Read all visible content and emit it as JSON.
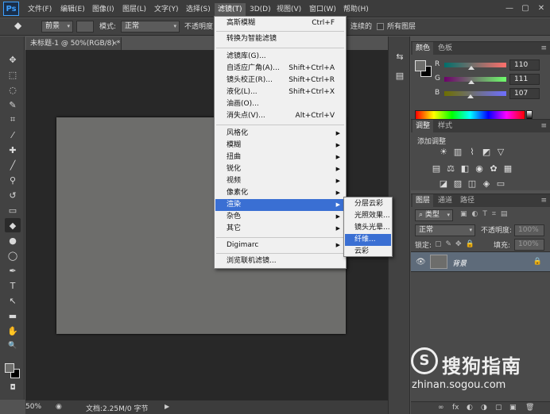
{
  "app": {
    "logo": "Ps"
  },
  "menubar": {
    "items": [
      "文件(F)",
      "编辑(E)",
      "图像(I)",
      "图层(L)",
      "文字(Y)",
      "选择(S)",
      "滤镜(T)",
      "3D(D)",
      "视图(V)",
      "窗口(W)",
      "帮助(H)"
    ],
    "active_index": 6,
    "window_controls": [
      "—",
      "▢",
      "✕"
    ]
  },
  "options": {
    "preset_select": "前景",
    "mode_label": "模式:",
    "mode_value": "正常",
    "opacity_label": "不透明度:",
    "contiguous_label": "连续的",
    "all_layers_label": "所有图层"
  },
  "document": {
    "tab_title": "未标题-1 @ 50%(RGB/8) *",
    "close_glyph": "×",
    "zoom": "50%",
    "doc_info": "文档:2.25M/0 字节",
    "canvas_color": "#6d6d6b"
  },
  "toolbar": {
    "icons": [
      "move-icon",
      "marquee-icon",
      "lasso-icon",
      "quick-select-icon",
      "crop-icon",
      "eyedropper-icon",
      "healing-brush-icon",
      "brush-icon",
      "clone-stamp-icon",
      "history-brush-icon",
      "eraser-icon",
      "paint-bucket-icon",
      "blur-icon",
      "dodge-icon",
      "pen-icon",
      "type-icon",
      "path-select-icon",
      "rectangle-icon",
      "hand-icon",
      "zoom-icon"
    ],
    "glyphs": [
      "✥",
      "⬚",
      "◌",
      "✎",
      "⌗",
      "⁄",
      "✚",
      "╱",
      "⚲",
      "↺",
      "▭",
      "◆",
      "●",
      "◯",
      "✒",
      "T",
      "↖",
      "▬",
      "✋",
      "🔍"
    ],
    "active_index": 11,
    "foreground_color": "#6d6d6b",
    "background_color": "#000000"
  },
  "filter_menu": {
    "items": [
      {
        "label": "高斯模糊",
        "shortcut": "Ctrl+F"
      },
      {
        "separator": true
      },
      {
        "label": "转换为智能滤镜"
      },
      {
        "separator": true
      },
      {
        "label": "滤镜库(G)..."
      },
      {
        "label": "自适应广角(A)...",
        "shortcut": "Shift+Ctrl+A"
      },
      {
        "label": "镜头校正(R)...",
        "shortcut": "Shift+Ctrl+R"
      },
      {
        "label": "液化(L)...",
        "shortcut": "Shift+Ctrl+X"
      },
      {
        "label": "油画(O)..."
      },
      {
        "label": "消失点(V)...",
        "shortcut": "Alt+Ctrl+V"
      },
      {
        "separator": true
      },
      {
        "label": "风格化",
        "submenu": true
      },
      {
        "label": "模糊",
        "submenu": true
      },
      {
        "label": "扭曲",
        "submenu": true
      },
      {
        "label": "锐化",
        "submenu": true
      },
      {
        "label": "视频",
        "submenu": true
      },
      {
        "label": "像素化",
        "submenu": true
      },
      {
        "label": "渲染",
        "submenu": true,
        "highlight": true
      },
      {
        "label": "杂色",
        "submenu": true
      },
      {
        "label": "其它",
        "submenu": true
      },
      {
        "separator": true
      },
      {
        "label": "Digimarc",
        "submenu": true
      },
      {
        "separator": true
      },
      {
        "label": "浏览联机滤镜..."
      }
    ]
  },
  "render_submenu": {
    "items": [
      {
        "label": "分层云彩"
      },
      {
        "label": "光照效果..."
      },
      {
        "label": "镜头光晕..."
      },
      {
        "label": "纤维...",
        "highlight": true
      },
      {
        "label": "云彩"
      }
    ]
  },
  "color_panel": {
    "tabs": [
      "颜色",
      "色板"
    ],
    "active_tab": 0,
    "channels": [
      {
        "label": "R",
        "value": "110",
        "level": 0.431
      },
      {
        "label": "G",
        "value": "111",
        "level": 0.435
      },
      {
        "label": "B",
        "value": "107",
        "level": 0.42
      }
    ]
  },
  "adjustments_panel": {
    "tabs": [
      "调整",
      "样式"
    ],
    "active_tab": 0,
    "title": "添加调整",
    "icons_row1": [
      "brightness-contrast-icon",
      "levels-icon",
      "curves-icon",
      "exposure-icon",
      "vibrance-icon"
    ],
    "glyphs_row1": [
      "☀",
      "▥",
      "⌇",
      "◩",
      "▽"
    ],
    "icons_row2": [
      "hue-saturation-icon",
      "color-balance-icon",
      "black-white-icon",
      "photo-filter-icon",
      "channel-mixer-icon",
      "color-lookup-icon"
    ],
    "glyphs_row2": [
      "▤",
      "⚖",
      "◧",
      "◉",
      "✿",
      "▦"
    ],
    "icons_row3": [
      "invert-icon",
      "posterize-icon",
      "threshold-icon",
      "selective-color-icon",
      "gradient-map-icon"
    ],
    "glyphs_row3": [
      "◪",
      "▨",
      "◫",
      "◈",
      "▭"
    ]
  },
  "layers_panel": {
    "tabs": [
      "图层",
      "通道",
      "路径"
    ],
    "active_tab": 0,
    "filter_select": "类型",
    "blend_mode": "正常",
    "opacity_label": "不透明度:",
    "opacity_value": "100%",
    "lock_label": "锁定:",
    "fill_label": "填充:",
    "fill_value": "100%",
    "layers": [
      {
        "name": "背景",
        "visible": true,
        "locked": true
      }
    ],
    "bottom_glyphs": [
      "∞",
      "fx",
      "◐",
      "◑",
      "▢",
      "▣",
      "🗑"
    ]
  },
  "watermark": {
    "logo_glyph": "S",
    "text": "搜狗指南",
    "url": "zhinan.sogou.com"
  }
}
